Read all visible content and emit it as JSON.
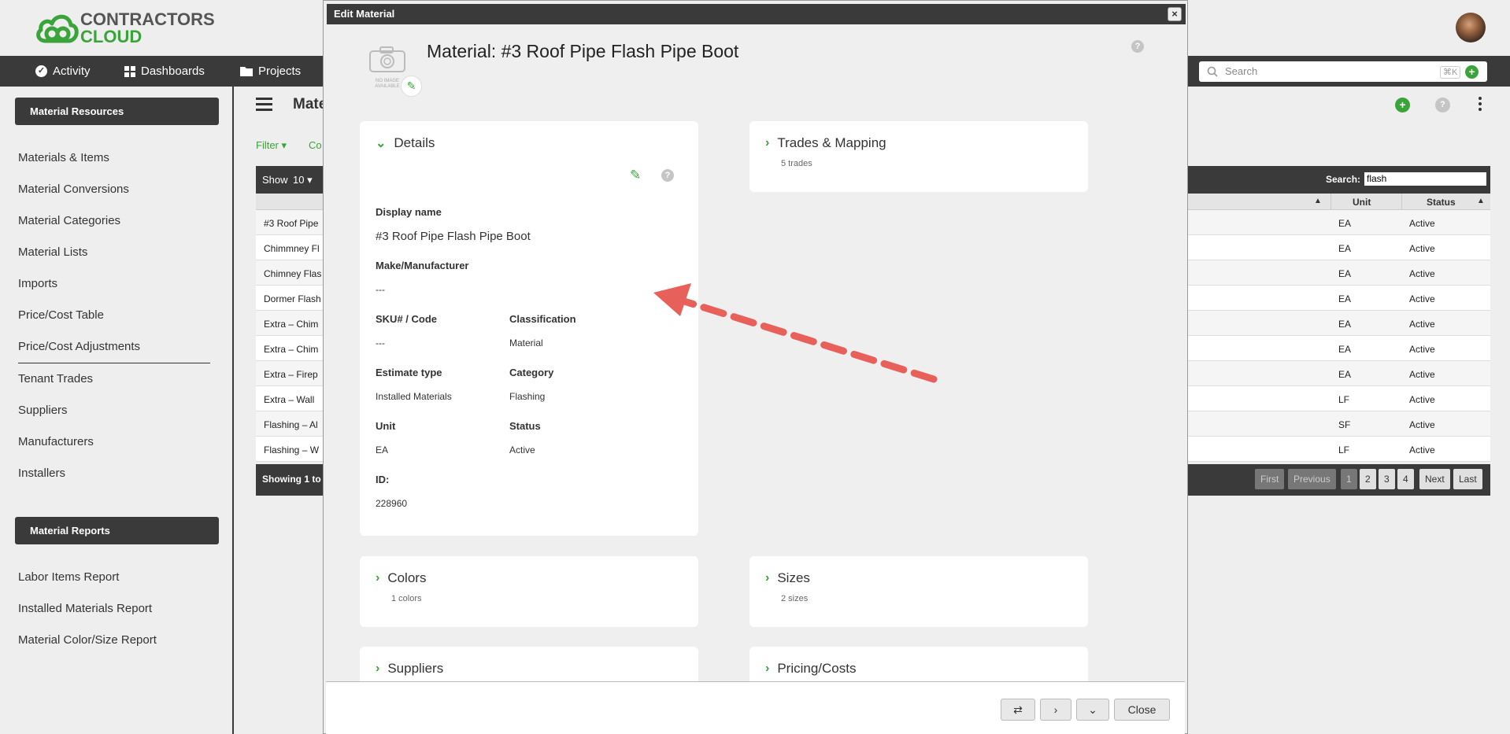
{
  "app": {
    "logo_line1": "CONTRACTORS",
    "logo_line2": "CLOUD"
  },
  "nav": {
    "items": [
      {
        "label": "Activity",
        "icon": "check-circle-icon"
      },
      {
        "label": "Dashboards",
        "icon": "grid-icon"
      },
      {
        "label": "Projects",
        "icon": "folder-icon"
      }
    ],
    "search_placeholder": "Search",
    "search_shortcut": "⌘K"
  },
  "sidebar": {
    "section1_title": "Material Resources",
    "section1_items": [
      "Materials & Items",
      "Material Conversions",
      "Material Categories",
      "Material Lists",
      "Imports",
      "Price/Cost Table",
      "Price/Cost Adjustments",
      "Tenant Trades",
      "Suppliers",
      "Manufacturers",
      "Installers"
    ],
    "section2_title": "Material Reports",
    "section2_items": [
      "Labor Items Report",
      "Installed Materials Report",
      "Material Color/Size Report"
    ]
  },
  "main": {
    "page_title": "Mate",
    "filter_label": "Filter",
    "co_label": "Co",
    "show_label": "Show",
    "show_value": "10",
    "search_label": "Search:",
    "search_value": "flash",
    "col_unit": "Unit",
    "col_status": "Status",
    "rows": [
      {
        "name": "#3 Roof Pipe",
        "unit": "EA",
        "status": "Active"
      },
      {
        "name": "Chimmney Fl",
        "unit": "EA",
        "status": "Active"
      },
      {
        "name": "Chimney Flas",
        "unit": "EA",
        "status": "Active"
      },
      {
        "name": "Dormer Flash",
        "unit": "EA",
        "status": "Active"
      },
      {
        "name": "Extra – Chim",
        "unit": "EA",
        "status": "Active"
      },
      {
        "name": "Extra – Chim",
        "unit": "EA",
        "status": "Active"
      },
      {
        "name": "Extra – Firep",
        "unit": "EA",
        "status": "Active"
      },
      {
        "name": "Extra – Wall",
        "unit": "LF",
        "status": "Active"
      },
      {
        "name": "Flashing – Al",
        "unit": "SF",
        "status": "Active"
      },
      {
        "name": "Flashing – W",
        "unit": "LF",
        "status": "Active"
      }
    ],
    "showing_text": "Showing 1 to",
    "pager": [
      "First",
      "Previous",
      "1",
      "2",
      "3",
      "4",
      "Next",
      "Last"
    ]
  },
  "modal": {
    "title": "Edit Material",
    "no_image_text": "NO IMAGE AVAILABLE",
    "heading": "Material: #3 Roof Pipe Flash Pipe Boot",
    "details": {
      "title": "Details",
      "display_name_label": "Display name",
      "display_name": "#3 Roof Pipe Flash Pipe Boot",
      "make_label": "Make/Manufacturer",
      "make": "---",
      "sku_label": "SKU# / Code",
      "sku": "---",
      "classification_label": "Classification",
      "classification": "Material",
      "estimate_type_label": "Estimate type",
      "estimate_type": "Installed Materials",
      "category_label": "Category",
      "category": "Flashing",
      "unit_label": "Unit",
      "unit": "EA",
      "status_label": "Status",
      "status": "Active",
      "id_label": "ID:",
      "id": "228960"
    },
    "trades": {
      "title": "Trades & Mapping",
      "sub": "5 trades"
    },
    "colors": {
      "title": "Colors",
      "sub": "1 colors"
    },
    "sizes": {
      "title": "Sizes",
      "sub": "2 sizes"
    },
    "suppliers": {
      "title": "Suppliers"
    },
    "pricing": {
      "title": "Pricing/Costs"
    },
    "close_label": "Close"
  },
  "colors": {
    "accent": "#3aa43a",
    "dark": "#3a3a3a",
    "arrow": "#e8605a"
  }
}
